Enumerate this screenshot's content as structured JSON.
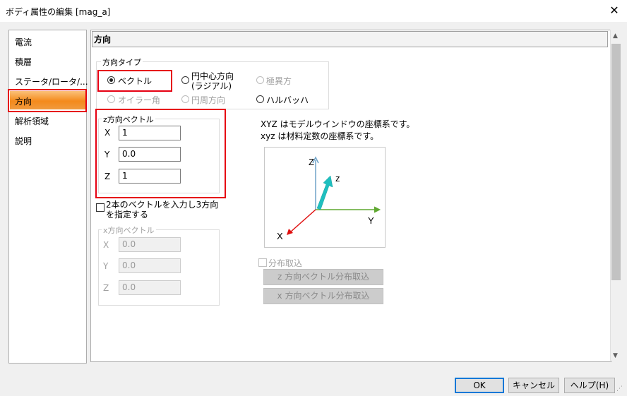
{
  "window": {
    "title": "ボディ属性の編集 [mag_a]",
    "close_label": "✕"
  },
  "sidebar": {
    "items": [
      {
        "label": "電流"
      },
      {
        "label": "積層"
      },
      {
        "label": "ステータ/ロータ/..."
      },
      {
        "label": "方向",
        "selected": true
      },
      {
        "label": "解析領域"
      },
      {
        "label": "説明"
      }
    ]
  },
  "panel": {
    "header": "方向",
    "direction_type": {
      "group_label": "方向タイプ",
      "options": {
        "vector": "ベクトル",
        "circle_center_line1": "円中心方向",
        "circle_center_line2": "(ラジアル)",
        "polar": "極異方",
        "euler": "オイラー角",
        "circumferential": "円周方向",
        "halbach": "ハルバッハ"
      },
      "selected": "vector"
    },
    "z_vector": {
      "group_label": "z方向ベクトル",
      "x_label": "X",
      "x_value": "1",
      "y_label": "Y",
      "y_value": "0.0",
      "z_label": "Z",
      "z_value": "1"
    },
    "two_vectors": {
      "line1": "2本のベクトルを入力し3方向",
      "line2": "を指定する",
      "checked": false
    },
    "x_vector": {
      "group_label": "x方向ベクトル",
      "x_label": "X",
      "x_value": "0.0",
      "y_label": "Y",
      "y_value": "0.0",
      "z_label": "Z",
      "z_value": "0.0"
    },
    "info": {
      "line1": "XYZ はモデルウインドウの座標系です。",
      "line2": "xyz は材料定数の座標系です。"
    },
    "axes_diagram": {
      "label_Z": "Z",
      "label_Y": "Y",
      "label_X": "X",
      "label_z": "z",
      "colors": {
        "Z_axis": "#6fa3c8",
        "Y_axis": "#5fa830",
        "X_axis": "#e01010",
        "z_vector": "#1fbfbf"
      }
    },
    "distribution": {
      "checkbox_label": "分布取込",
      "z_button": "z 方向ベクトル分布取込",
      "x_button": "x 方向ベクトル分布取込"
    }
  },
  "footer": {
    "ok": "OK",
    "cancel": "キャンセル",
    "help": "ヘルプ(H)"
  },
  "colors": {
    "selection": "#f48a1c",
    "highlight": "#e60012",
    "default_button_border": "#0078d7"
  }
}
